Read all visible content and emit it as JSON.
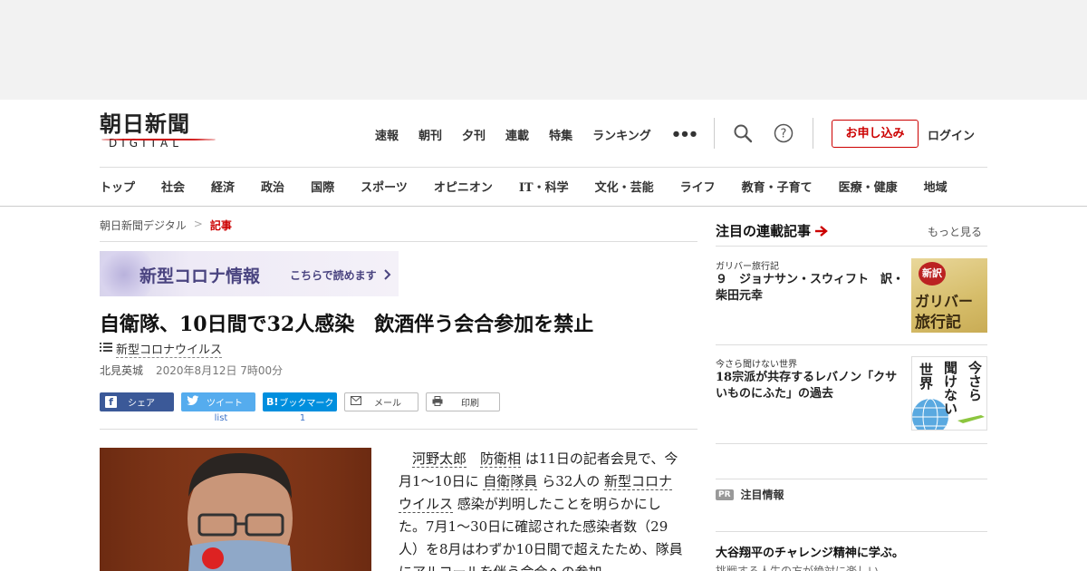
{
  "header": {
    "logo": {
      "main": "朝日新聞",
      "sub": "DIGITAL"
    },
    "topnav": [
      "速報",
      "朝刊",
      "夕刊",
      "連載",
      "特集",
      "ランキング"
    ],
    "more_label": "•••",
    "subscribe_label": "お申し込み",
    "login_label": "ログイン",
    "sections": [
      "トップ",
      "社会",
      "経済",
      "政治",
      "国際",
      "スポーツ",
      "オピニオン",
      "IT・科学",
      "文化・芸能",
      "ライフ",
      "教育・子育て",
      "医療・健康",
      "地域"
    ]
  },
  "breadcrumb": {
    "home": "朝日新聞デジタル",
    "separator": ">",
    "current": "記事"
  },
  "banner": {
    "title": "新型コロナ情報",
    "link": "こちらで読めます"
  },
  "article": {
    "headline": "自衛隊、10日間で32人感染　飲酒伴う会合参加を禁止",
    "topic_icon": "list-icon",
    "topic": "新型コロナウイルス",
    "author": "北見英城",
    "date": "2020年8月12日 7時00分",
    "share": {
      "facebook": "シェア",
      "twitter": "ツイート",
      "twitter_count": "list",
      "hatena_mark": "B!",
      "hatena": "ブックマーク",
      "hatena_count": "1",
      "mail": "メール",
      "print": "印刷"
    },
    "body": {
      "p1": "　",
      "l1": "河野太郎",
      "p2": "　",
      "l2": "防衛相",
      "p3": " は11日の記者会見で、今月1～10日に ",
      "l3": "自衛隊員",
      "p4": " ら32人の ",
      "l4": "新型コロナウイルス",
      "p5": " 感染が判明したことを明らかにした。7月1～30日に確認された感染者数（29人）を8月はわずか10日間で超えたため、隊員にアルコールを伴う会合への参加"
    }
  },
  "sidebar": {
    "heading": "注目の連載記事",
    "more": "もっと見る",
    "items": [
      {
        "kicker": "ガリバー旅行記",
        "title": "９　ジョナサン・スウィフト　訳・柴田元幸",
        "thumb_badge": "新訳",
        "thumb_title1": "ガリバー",
        "thumb_title2": "旅行記"
      },
      {
        "kicker": "今さら聞けない世界",
        "title": "18宗派が共存するレバノン「クサいものにふた」の過去",
        "thumb_col1": "今さら",
        "thumb_col2": "聞けない",
        "thumb_col3": "世界"
      }
    ],
    "pr_badge": "PR",
    "pr_label": "注目情報",
    "pr_title": "大谷翔平のチャレンジ精神に学ぶ。",
    "pr_desc": "挑戦する人生の方が絶対に楽しい"
  },
  "colors": {
    "accent": "#cc0000",
    "facebook": "#3b5998",
    "twitter": "#55acee",
    "hatena": "#008fde"
  }
}
